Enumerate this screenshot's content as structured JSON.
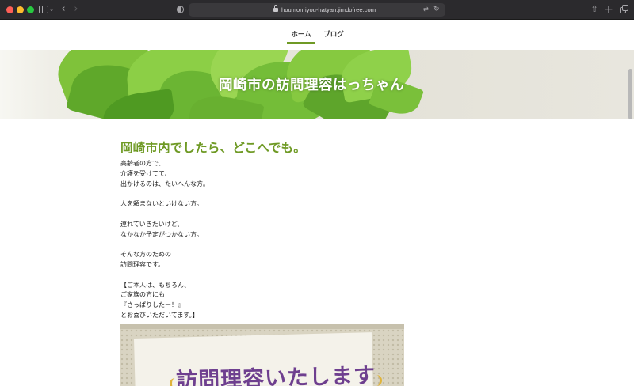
{
  "browser": {
    "url": "houmonriyou-hatyan.jimdofree.com",
    "icons": [
      "sidebar-icon",
      "chevron-down-icon",
      "back-icon",
      "forward-icon",
      "privacy-shield-icon",
      "lock-icon",
      "translate-icon",
      "reload-icon",
      "share-icon",
      "new-tab-icon",
      "tab-overview-icon"
    ]
  },
  "nav": {
    "items": [
      {
        "label": "ホーム",
        "active": true
      },
      {
        "label": "ブログ",
        "active": false
      }
    ]
  },
  "hero": {
    "title": "岡崎市の訪問理容はっちゃん"
  },
  "main": {
    "headline": "岡崎市内でしたら、どこへでも。",
    "lines": [
      "高齢者の方で、",
      "介護を受けてて、",
      "出かけるのは、たいへんな方。",
      "",
      "人を頼まないといけない方。",
      "",
      "連れていきたいけど、",
      "なかなか予定がつかない方。",
      "",
      "そんな方のための",
      "訪問理容です。",
      "",
      "【ご本人は、もちろん、",
      "ご家族の方にも",
      "『さっぱりしたー！』",
      "とお喜びいただいてます。】"
    ],
    "photo_text": "訪問理容いたします"
  },
  "colors": {
    "accent_green": "#6f9a25",
    "photo_text_purple": "#6e3f8f",
    "chrome_bg": "#2b2a2d"
  }
}
